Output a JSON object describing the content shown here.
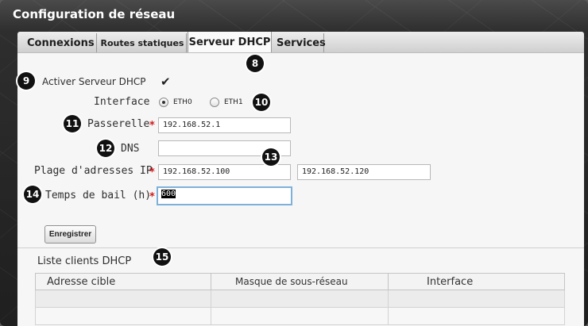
{
  "window": {
    "title": "Configuration de réseau"
  },
  "tabs": [
    {
      "label": "Connexions"
    },
    {
      "label": "Routes statiques"
    },
    {
      "label": "Serveur DHCP"
    },
    {
      "label": "Services"
    }
  ],
  "form": {
    "enable_label": "Activer Serveur DHCP",
    "enable_checked": true,
    "check_glyph": "✔",
    "interface_label": "Interface",
    "interface_options": [
      "ETH0",
      "ETH1"
    ],
    "interface_selected": "ETH0",
    "gateway_label": "Passerelle",
    "gateway_value": "192.168.52.1",
    "dns_label": "DNS",
    "dns_value": "",
    "range_label": "Plage d'adresses IP",
    "range_start": "192.168.52.100",
    "range_end": "192.168.52.120",
    "lease_label": "Temps de bail (h)",
    "lease_value": "600",
    "required_mark": "*",
    "save_button": "Enregistrer"
  },
  "clients": {
    "title": "Liste clients DHCP",
    "columns": [
      "Adresse cible",
      "Masque de sous-réseau",
      "Interface"
    ],
    "rows": [
      [
        "",
        "",
        ""
      ],
      [
        "",
        "",
        ""
      ]
    ]
  },
  "callouts": [
    "8",
    "9",
    "10",
    "11",
    "12",
    "13",
    "14",
    "15"
  ],
  "colors": {
    "required": "#d21b1b",
    "focus_border": "#7fb0da",
    "badge": "#111111"
  }
}
